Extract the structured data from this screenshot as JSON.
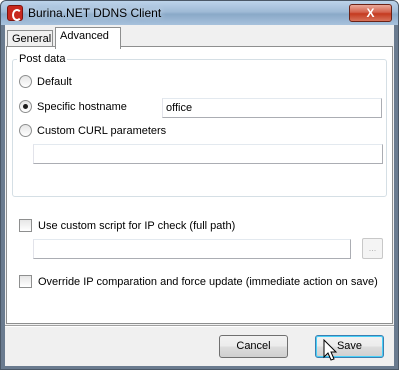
{
  "window": {
    "title": "Burina.NET DDNS Client",
    "close_label": "X"
  },
  "tabs": [
    {
      "label": "General",
      "active": false
    },
    {
      "label": "Advanced",
      "active": true
    }
  ],
  "post_data": {
    "legend": "Post data",
    "default_label": "Default",
    "specific_label": "Specific hostname",
    "specific_value": "office",
    "custom_curl_label": "Custom CURL parameters",
    "custom_curl_value": "",
    "selected": "specific"
  },
  "custom_script": {
    "label": "Use custom script for IP check (full path)",
    "checked": false,
    "value": "",
    "browse_label": "..."
  },
  "override": {
    "label": "Override IP comparation and force update (immediate action on save)",
    "checked": false
  },
  "buttons": {
    "cancel": "Cancel",
    "save": "Save"
  }
}
